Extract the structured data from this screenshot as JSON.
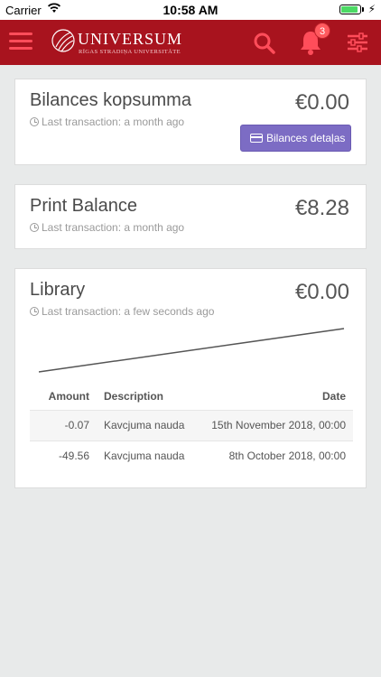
{
  "status_bar": {
    "carrier": "Carrier",
    "time": "10:58 AM",
    "battery_level": 0.9
  },
  "header": {
    "logo_name": "UNIVERSUM",
    "logo_sub": "RĪGAS STRADIŅA UNIVERSITĀTE",
    "notification_count": "3",
    "icons": [
      "hamburger-menu-icon",
      "search-icon",
      "bell-icon",
      "sliders-icon"
    ],
    "brand_color": "#a8131e",
    "accent_color": "#ff4d5a"
  },
  "cards": [
    {
      "title": "Bilances kopsumma",
      "amount": "€0.00",
      "last_transaction": "Last transaction: a month ago",
      "button_label": "Bilances detaļas"
    },
    {
      "title": "Print Balance",
      "amount": "€8.28",
      "last_transaction": "Last transaction: a month ago"
    },
    {
      "title": "Library",
      "amount": "€0.00",
      "last_transaction": "Last transaction: a few seconds ago",
      "table": {
        "headers": {
          "amount": "Amount",
          "description": "Description",
          "date": "Date"
        },
        "rows": [
          {
            "amount": "-0.07",
            "description": "Kavcjuma nauda",
            "date": "15th November 2018, 00:00"
          },
          {
            "amount": "-49.56",
            "description": "Kavcjuma nauda",
            "date": "8th October 2018, 00:00"
          }
        ]
      }
    }
  ],
  "button_color": "#7c6cc4"
}
